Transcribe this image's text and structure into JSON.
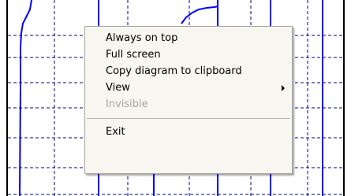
{
  "context_menu": {
    "items": [
      {
        "label": "Always on top",
        "enabled": true,
        "has_submenu": false
      },
      {
        "label": "Full screen",
        "enabled": true,
        "has_submenu": false
      },
      {
        "label": "Copy diagram to clipboard",
        "enabled": true,
        "has_submenu": false
      },
      {
        "label": "View",
        "enabled": true,
        "has_submenu": true
      },
      {
        "label": "Invisible",
        "enabled": false,
        "has_submenu": false
      },
      {
        "label": "Exit",
        "enabled": true,
        "has_submenu": false
      }
    ]
  },
  "colors": {
    "background": "#ffffff",
    "frame": "#000000",
    "trace": "#0000ff",
    "grid": "#00008b",
    "menu_background": "#f7f6f1",
    "menu_disabled_text": "#a6a39a"
  }
}
